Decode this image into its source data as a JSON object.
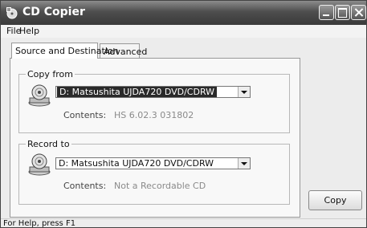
{
  "window": {
    "title": "CD Copier",
    "icon": "cd-copier-app-icon"
  },
  "menu": {
    "file": "File",
    "help": "Help"
  },
  "tabs": [
    {
      "label": "Source and Destination",
      "active": true
    },
    {
      "label": "Advanced",
      "active": false
    }
  ],
  "copy_from": {
    "legend": "Copy from",
    "drive": "D: Matsushita UJDA720 DVD/CDRW",
    "contents_label": "Contents:",
    "contents_value": "HS 6.02.3 031802"
  },
  "record_to": {
    "legend": "Record to",
    "drive": "D: Matsushita UJDA720 DVD/CDRW",
    "contents_label": "Contents:",
    "contents_value": "Not a Recordable CD"
  },
  "buttons": {
    "copy": "Copy"
  },
  "status": {
    "text": "For Help, press F1"
  }
}
